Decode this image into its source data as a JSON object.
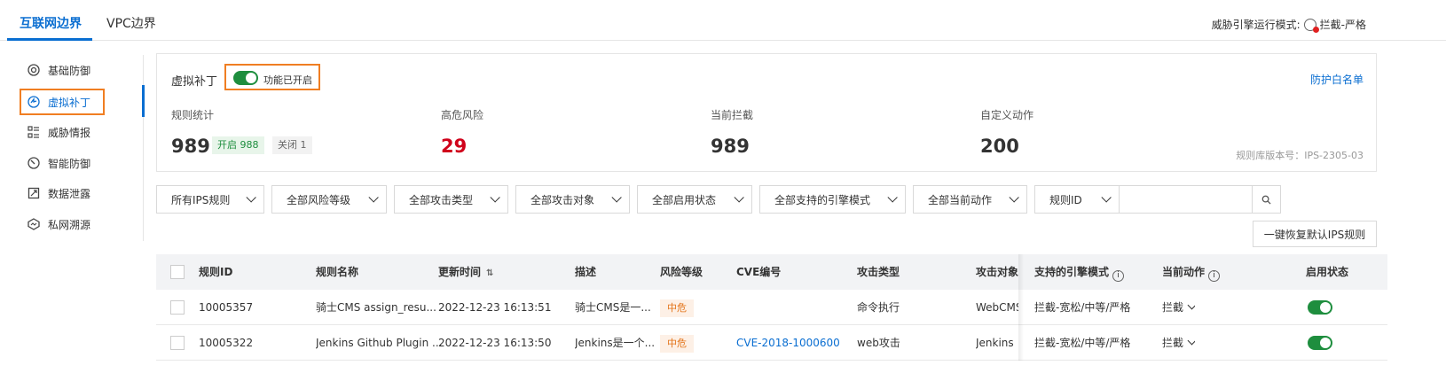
{
  "tabs": [
    {
      "label": "互联网边界"
    },
    {
      "label": "VPC边界"
    }
  ],
  "engine_mode": {
    "label": "威胁引擎运行模式:",
    "value": "拦截-严格"
  },
  "sidebar": {
    "items": [
      {
        "label": "基础防御",
        "icon": "shield-base-icon"
      },
      {
        "label": "虚拟补丁",
        "icon": "patch-icon"
      },
      {
        "label": "威胁情报",
        "icon": "intel-icon"
      },
      {
        "label": "智能防御",
        "icon": "smart-defense-icon"
      },
      {
        "label": "数据泄露",
        "icon": "data-leak-icon"
      },
      {
        "label": "私网溯源",
        "icon": "trace-icon"
      }
    ],
    "active_index": 1
  },
  "summary": {
    "title": "虚拟补丁",
    "switch_label": "功能已开启",
    "whitelist_link": "防护白名单",
    "stats": [
      {
        "label": "规则统计",
        "value": "989"
      },
      {
        "label": "高危风险",
        "value": "29"
      },
      {
        "label": "当前拦截",
        "value": "989"
      },
      {
        "label": "自定义动作",
        "value": "200"
      }
    ],
    "tag_on": "开启 988",
    "tag_off": "关闭 1",
    "version": "规则库版本号：IPS-2305-03"
  },
  "filters": [
    {
      "label": "所有IPS规则"
    },
    {
      "label": "全部风险等级"
    },
    {
      "label": "全部攻击类型"
    },
    {
      "label": "全部攻击对象"
    },
    {
      "label": "全部启用状态"
    },
    {
      "label": "全部支持的引擎模式"
    },
    {
      "label": "全部当前动作"
    }
  ],
  "rule_id_filter": {
    "label": "规则ID",
    "value": ""
  },
  "reset_button": "一键恢复默认IPS规则",
  "table": {
    "headers": {
      "rule_id": "规则ID",
      "rule_name": "规则名称",
      "updated": "更新时间",
      "desc": "描述",
      "risk": "风险等级",
      "cve": "CVE编号",
      "attack_type": "攻击类型",
      "attack_target": "攻击对象",
      "engine_mode": "支持的引擎模式",
      "current_action": "当前动作",
      "enabled": "启用状态"
    },
    "rows": [
      {
        "rule_id": "10005357",
        "rule_name": "骑士CMS assign_resu...",
        "updated": "2022-12-23 16:13:51",
        "desc": "骑士CMS是一...",
        "risk": "中危",
        "cve": "",
        "attack_type": "命令执行",
        "attack_target": "WebCMS",
        "engine_mode": "拦截-宽松/中等/严格",
        "current_action": "拦截",
        "enabled": true
      },
      {
        "rule_id": "10005322",
        "rule_name": "Jenkins Github Plugin ...",
        "updated": "2022-12-23 16:13:50",
        "desc": "Jenkins是一个...",
        "risk": "中危",
        "cve": "CVE-2018-1000600",
        "attack_type": "web攻击",
        "attack_target": "Jenkins",
        "engine_mode": "拦截-宽松/中等/严格",
        "current_action": "拦截",
        "enabled": true
      }
    ]
  },
  "colors": {
    "accent": "#0a6ed1",
    "highlight": "#f07e22",
    "switch_on": "#1e8e3e",
    "danger": "#d0021b"
  }
}
